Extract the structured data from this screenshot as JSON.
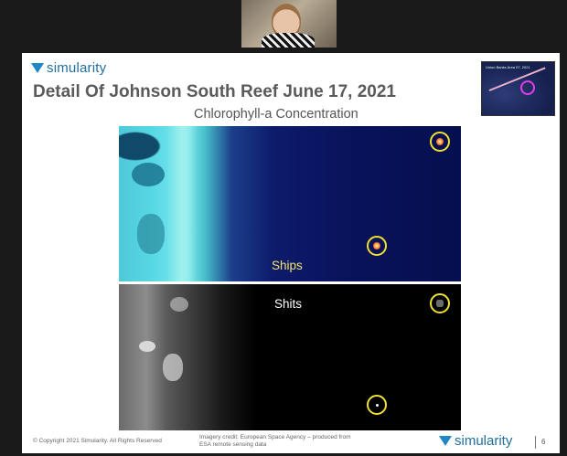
{
  "logo": {
    "text": "simularity"
  },
  "slide": {
    "title": "Detail Of Johnson South Reef June 17, 2021",
    "subtitle": "Chlorophyll-a Concentration",
    "thumbnail_title": "Union Banks Area 07, 2021",
    "top_panel_label": "Ships",
    "bottom_panel_label": "Shits",
    "footer_copyright": "© Copyright 2021 Simularity. All Rights Reserved",
    "footer_credit": "Imagery credit: European Space Agency – produced from ESA remote sensing data",
    "footer_logo": "simularity",
    "page_number": "6"
  },
  "colors": {
    "brand": "#1e88c7",
    "highlight_ring": "#f0e030",
    "thumbnail_circle": "#e23ee8"
  }
}
